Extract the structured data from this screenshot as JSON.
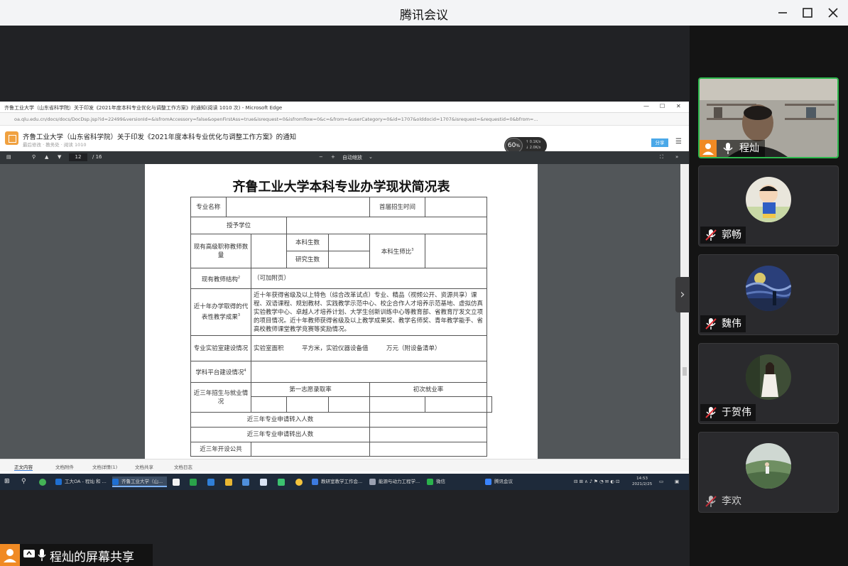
{
  "app": {
    "title": "腾讯会议"
  },
  "window": {
    "min": "—",
    "max": "☐",
    "close": "✕"
  },
  "browser": {
    "title": "齐鲁工业大学（山东省科学院）关于印发《2021年度本科专业优化与调整工作方案》的通知(阅读 1010 次) - Microsoft Edge",
    "address": "oa.qlu.edu.cn/docs/docs/DocDsp.jsp?id=22499&versionId=&isfromAccessory=false&openFirstAss=true&isrequest=0&isfromflow=0&c=&from=&userCategory=0&id=1707&olddocid=1707&isrequest=&requestid=0&bfrom=..."
  },
  "document": {
    "title": "齐鲁工业大学（山东省科学院）关于印发《2021年度本科专业优化与调整工作方案》的通知",
    "meta": "最后修改 · 教务处 · 阅读 1010",
    "share": "分享",
    "speed_value": "60",
    "speed_unit": "%"
  },
  "pdf": {
    "page_current": "12",
    "page_total": "/ 16",
    "zoom": "自动缩放",
    "plus": "+",
    "minus": "−"
  },
  "form": {
    "title": "齐鲁工业大学本科专业办学现状简况表",
    "r1_a": "专业名称",
    "r1_b": "首届招生时间",
    "r2_a": "授予学位",
    "r3_a": "现有高级职称教师数量",
    "r3_b": "本科生数",
    "r3_c": "研究生数",
    "r3_d": "本科生师比",
    "r4_a": "现有教师结构",
    "r4_b": "（可加附页）",
    "r5_a": "近十年办学取得的代表性教学成果",
    "r5_b": "近十年获得省级及以上特色（综合改革试点）专业、精品（视频公开、资源共享）课程、双语课程、规划教材、实践教学示范中心、校企合作人才培养示范基地、虚拟仿真实验教学中心、卓越人才培养计划、大学生创新训练中心等教育部、省教育厅发文立项的项目情况。近十年教师获得省级及以上教学成果奖、教学名师奖、青年教学能手、省高校教师课堂教学竞赛等奖励情况。",
    "r6_a": "专业实验室建设情况",
    "r6_b": "实验室面积　　　平方米，实验仪器设备值　　　万元（附设备清单）",
    "r7_a": "学科平台建设情况",
    "r8_a": "近三年招生与就业情况",
    "r8_b": "第一志愿录取率",
    "r8_c": "初次就业率",
    "r9_a": "近三年专业申请转入人数",
    "r10_a": "近三年专业申请转出人数",
    "r11_a": "近三年开设公共"
  },
  "doctabs": [
    "正文内容",
    "文档附件",
    "文档详情(1)",
    "文档共享",
    "文档日志"
  ],
  "taskbar": {
    "items": [
      "工大OA - 程灿 和 ...",
      "齐鲁工业大学（山...",
      "教研室教学工作会...",
      "能源与动力工程学...",
      "微信",
      "腾讯会议"
    ],
    "time": "14:53",
    "date": "2021/2/25"
  },
  "sharer": {
    "label": "程灿的屏幕共享"
  },
  "participants": [
    {
      "name": "程灿",
      "mic": "on"
    },
    {
      "name": "郭畅",
      "mic": "muted"
    },
    {
      "name": "魏伟",
      "mic": "muted"
    },
    {
      "name": "于贺伟",
      "mic": "muted"
    },
    {
      "name": "李欢",
      "mic": "muted"
    }
  ]
}
